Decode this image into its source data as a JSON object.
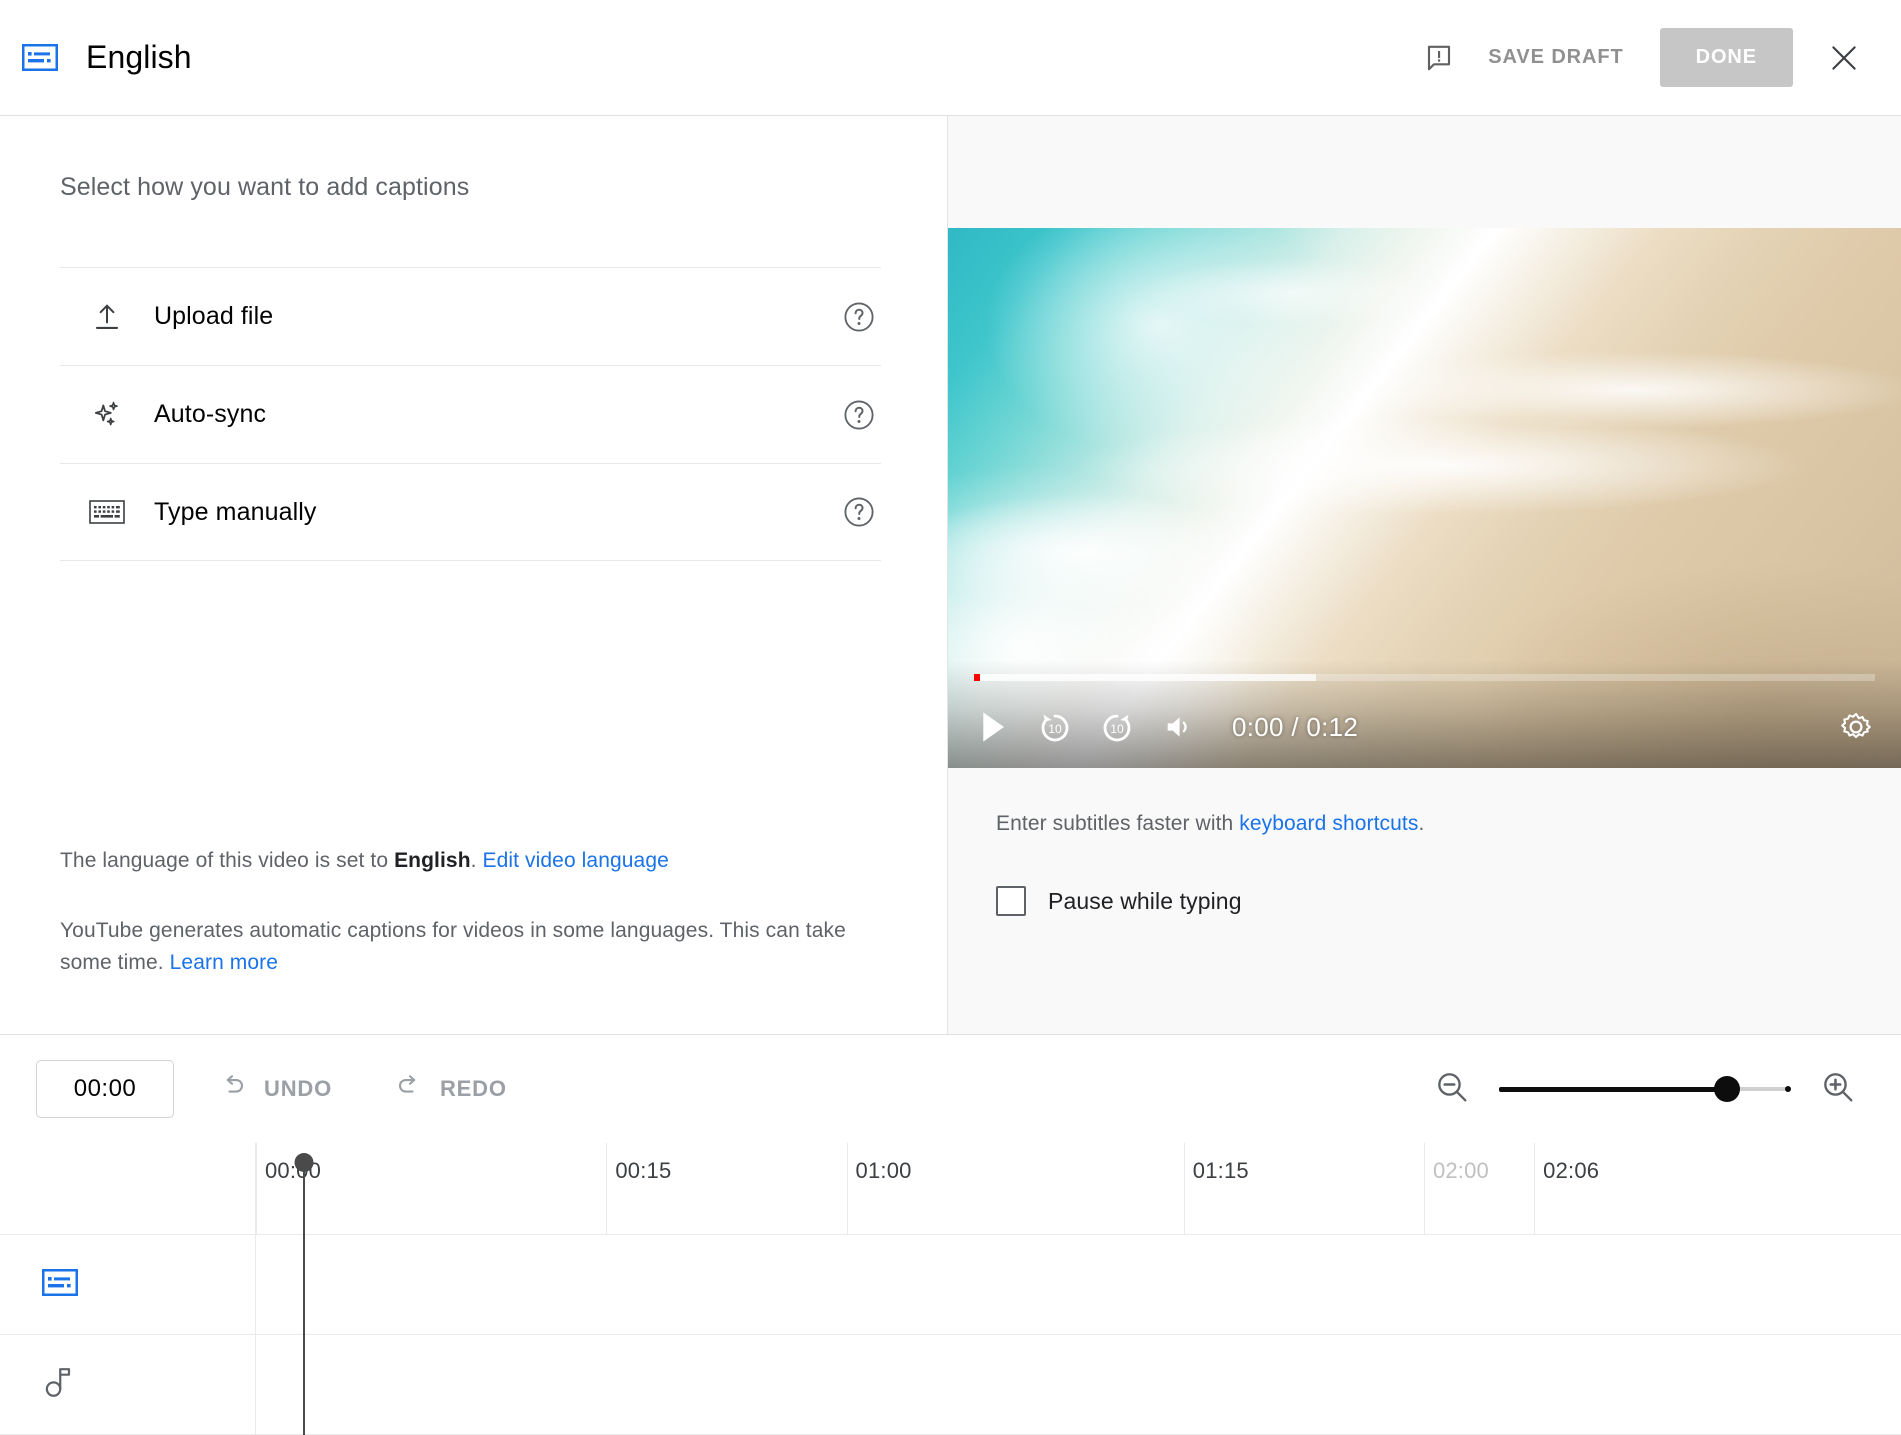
{
  "header": {
    "cc_icon": "closed-captions-icon",
    "title": "English",
    "feedback_icon": "feedback-flag-icon",
    "save_draft_label": "SAVE DRAFT",
    "done_label": "DONE",
    "close_icon": "close-icon"
  },
  "left_pane": {
    "heading": "Select how you want to add captions",
    "methods": [
      {
        "icon": "upload-icon",
        "label": "Upload file",
        "help": "help-icon"
      },
      {
        "icon": "sparkles-icon",
        "label": "Auto-sync",
        "help": "help-icon"
      },
      {
        "icon": "keyboard-icon",
        "label": "Type manually",
        "help": "help-icon"
      }
    ],
    "language_note_prefix": "The language of this video is set to ",
    "language_value": "English",
    "language_note_suffix": ". ",
    "edit_language_link": "Edit video language",
    "auto_caption_note": "YouTube generates automatic captions for videos in some languages. This can take some time. ",
    "learn_more_link": "Learn more"
  },
  "right_pane": {
    "player": {
      "play_icon": "play-icon",
      "rewind_label": "10",
      "rewind_icon": "replay-10-icon",
      "forward_label": "10",
      "forward_icon": "forward-10-icon",
      "volume_icon": "volume-icon",
      "current_time": "0:00",
      "time_separator": "/",
      "duration": "0:12",
      "time_display": "0:00 / 0:12",
      "settings_icon": "settings-gear-icon",
      "progress_played_pct": 0.7,
      "progress_buffered_pct": 38,
      "played_color": "#ff0000"
    },
    "hint_prefix": "Enter subtitles faster with ",
    "hint_link": "keyboard shortcuts",
    "hint_suffix": ".",
    "pause_while_typing_label": "Pause while typing",
    "pause_while_typing_checked": false
  },
  "toolbar": {
    "timecode_value": "00:00",
    "undo_icon": "undo-arrow-icon",
    "undo_label": "UNDO",
    "redo_icon": "redo-arrow-icon",
    "redo_label": "REDO",
    "zoom_out_icon": "zoom-out-icon",
    "zoom_in_icon": "zoom-in-icon",
    "zoom_level_pct": 78
  },
  "timeline": {
    "ticks": [
      {
        "label": "00:00",
        "left_pct": 0,
        "muted": false
      },
      {
        "label": "00:15",
        "left_pct": 21.3,
        "muted": false
      },
      {
        "label": "01:00",
        "left_pct": 35.9,
        "muted": false
      },
      {
        "label": "01:15",
        "left_pct": 56.4,
        "muted": false
      },
      {
        "label": "02:00",
        "left_pct": 71.0,
        "muted": true
      },
      {
        "label": "02:06",
        "left_pct": 77.7,
        "muted": false
      }
    ],
    "playhead_position": "00:00",
    "tracks": [
      {
        "icon": "closed-captions-icon",
        "name": "subtitles-track",
        "color": "#1a73e8"
      },
      {
        "icon": "music-note-icon",
        "name": "audio-track",
        "color": "#5f6368"
      }
    ]
  },
  "colors": {
    "accent_blue": "#1a73e8",
    "disabled_gray": "#c6c6c6",
    "text_primary": "#030303",
    "text_secondary": "#5f6368"
  }
}
